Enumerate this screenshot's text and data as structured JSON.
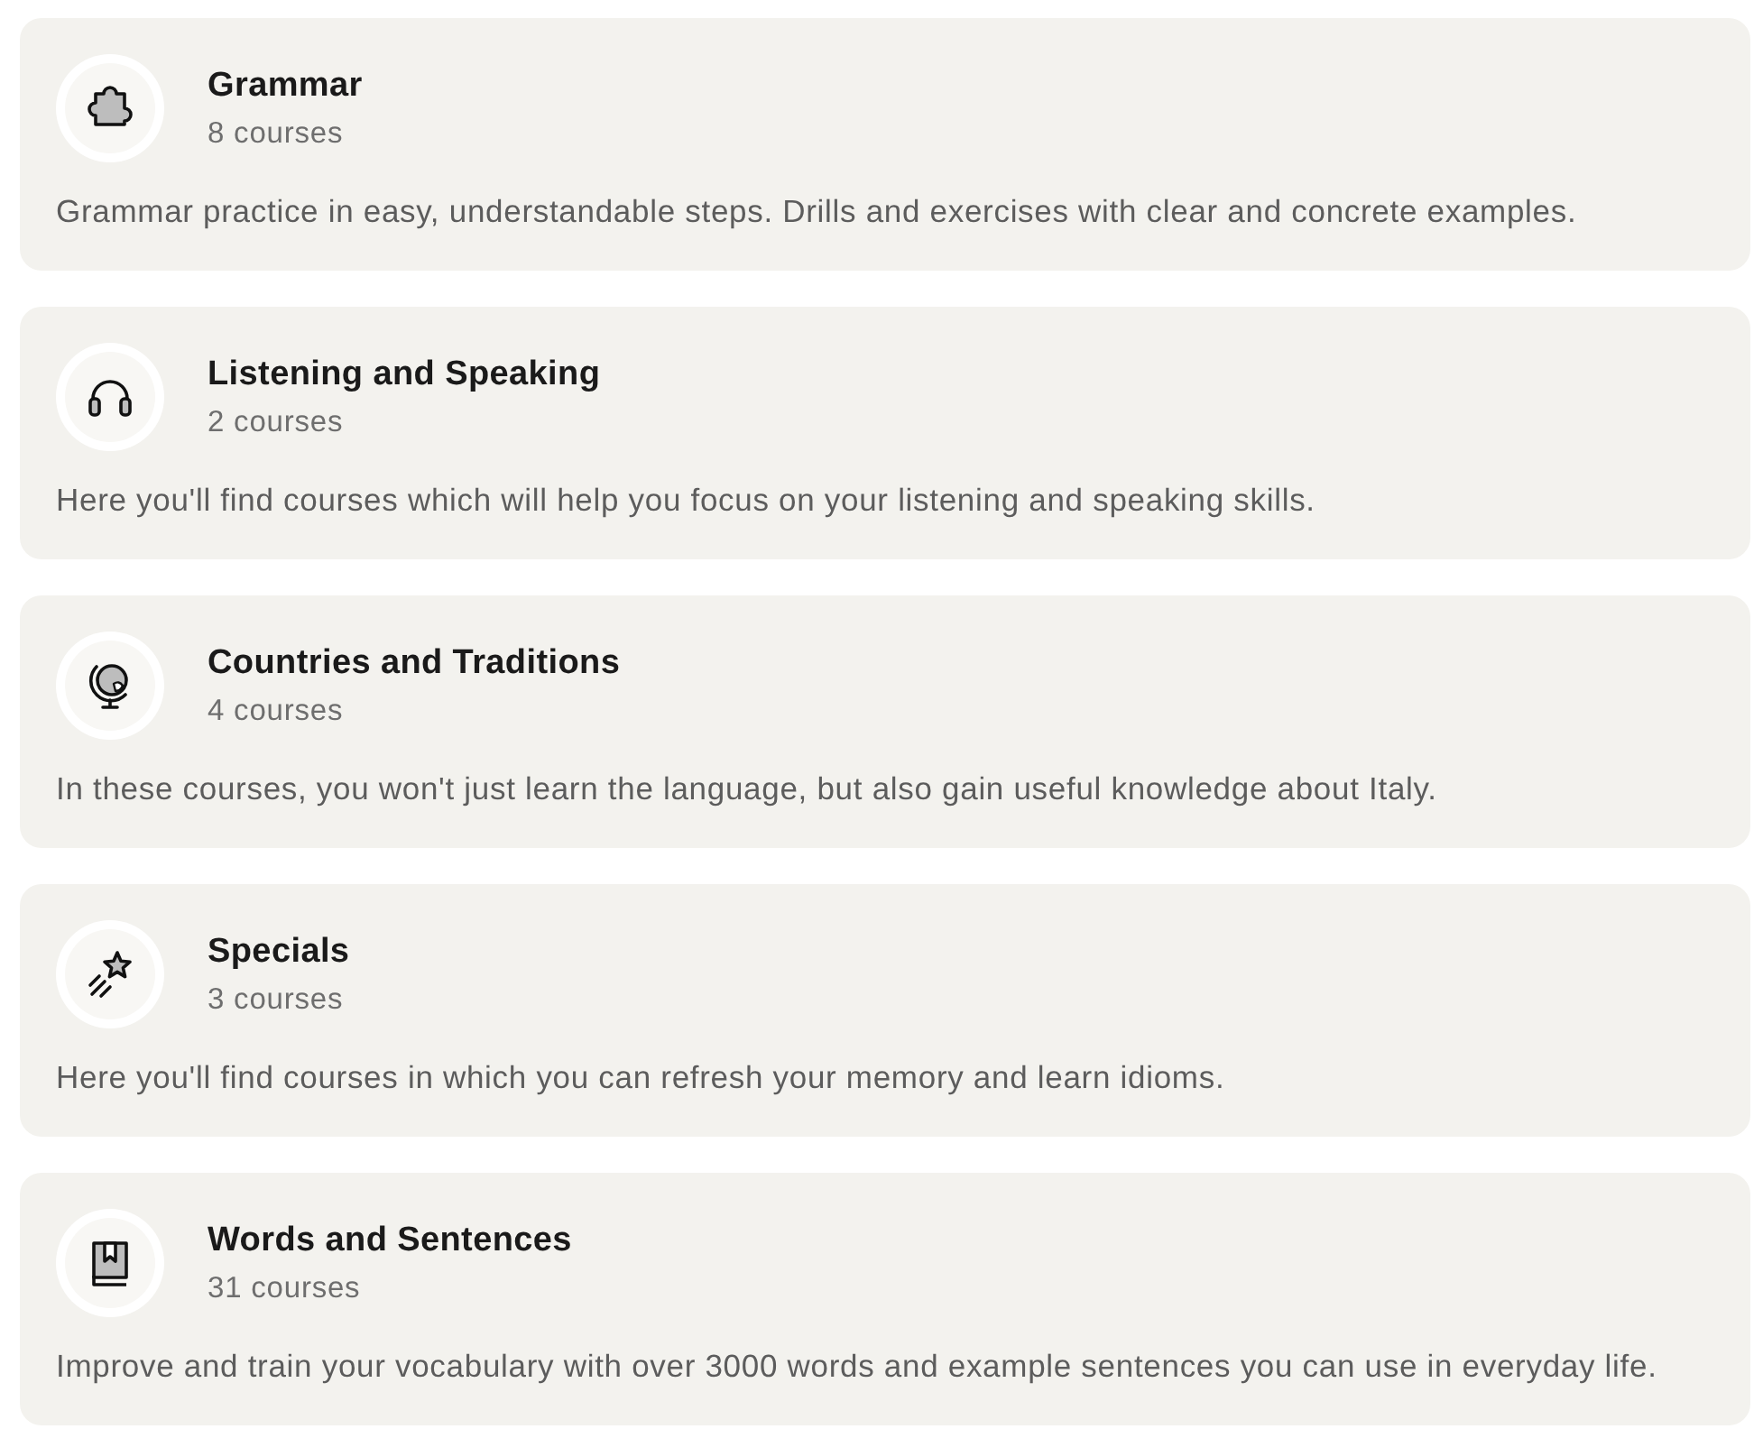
{
  "categories": [
    {
      "title": "Grammar",
      "count": "8 courses",
      "description": "Grammar practice in easy, understandable steps. Drills and exercises with clear and concrete examples."
    },
    {
      "title": "Listening and Speaking",
      "count": "2 courses",
      "description": "Here you'll find courses which will help you focus on your listening and speaking skills."
    },
    {
      "title": "Countries and Traditions",
      "count": "4 courses",
      "description": "In these courses, you won't just learn the language, but also gain useful knowledge about Italy."
    },
    {
      "title": "Specials",
      "count": "3 courses",
      "description": "Here you'll find courses in which you can refresh your memory and learn idioms."
    },
    {
      "title": "Words and Sentences",
      "count": "31 courses",
      "description": "Improve and train your vocabulary with over 3000 words and example sentences you can use in everyday life."
    }
  ]
}
